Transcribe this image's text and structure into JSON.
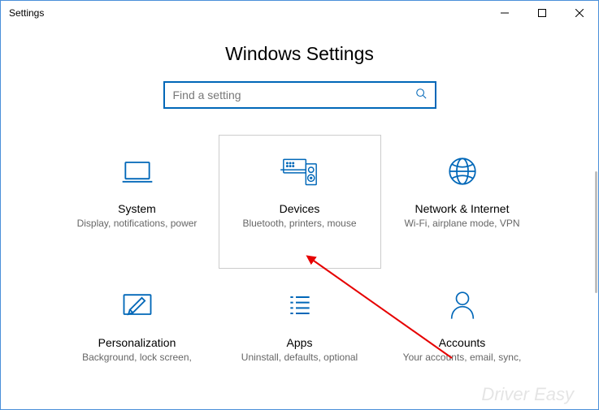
{
  "window_title": "Settings",
  "page_title": "Windows Settings",
  "search": {
    "placeholder": "Find a setting"
  },
  "tiles": [
    {
      "label": "System",
      "desc": "Display, notifications, power"
    },
    {
      "label": "Devices",
      "desc": "Bluetooth, printers, mouse"
    },
    {
      "label": "Network & Internet",
      "desc": "Wi-Fi, airplane mode, VPN"
    },
    {
      "label": "Personalization",
      "desc": "Background, lock screen,"
    },
    {
      "label": "Apps",
      "desc": "Uninstall, defaults, optional"
    },
    {
      "label": "Accounts",
      "desc": "Your accounts, email, sync,"
    }
  ],
  "accent": "#0067b8",
  "watermark": "Driver Easy"
}
